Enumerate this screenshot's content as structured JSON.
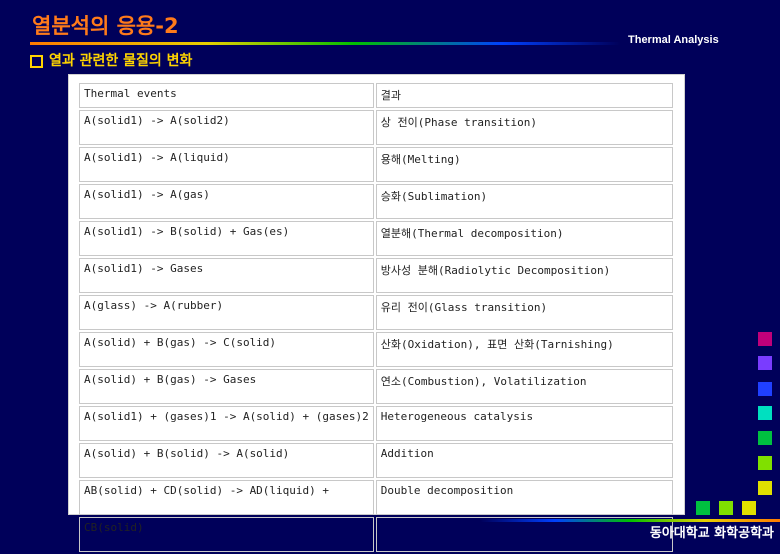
{
  "header": {
    "title": "열분석의 응용-2",
    "subtitle": "열과 관련한 물질의 변화",
    "corner_tag": "Thermal Analysis"
  },
  "table": {
    "headers": [
      "Thermal events",
      "결과"
    ],
    "rows": [
      [
        "A(solid1) -> A(solid2)",
        "상 전이(Phase transition)"
      ],
      [
        "A(solid1) -> A(liquid)",
        "용해(Melting)"
      ],
      [
        "A(solid1) -> A(gas)",
        "승화(Sublimation)"
      ],
      [
        "A(solid1) -> B(solid) + Gas(es)",
        "열분해(Thermal decomposition)"
      ],
      [
        "A(solid1) -> Gases",
        "방사성 분해(Radiolytic Decomposition)"
      ],
      [
        "A(glass) -> A(rubber)",
        "유리 전이(Glass transition)"
      ],
      [
        "A(solid) + B(gas) -> C(solid)",
        "산화(Oxidation), 표면 산화(Tarnishing)"
      ],
      [
        "A(solid) + B(gas) -> Gases",
        "연소(Combustion), Volatilization"
      ],
      [
        "A(solid1) + (gases)1 -> A(solid) + (gases)2",
        "Heterogeneous catalysis"
      ],
      [
        "A(solid) + B(solid) -> A(solid)",
        "Addition"
      ],
      [
        "AB(solid) + CD(solid) -> AD(liquid) +",
        "Double decomposition"
      ],
      [
        "CB(solid)",
        ""
      ]
    ]
  },
  "footer": {
    "text": "동아대학교 화학공학과"
  },
  "colors": {
    "background": "#00005a",
    "title": "#ff7a1a",
    "subtitle": "#ffd400",
    "squares": [
      "#c0007a",
      "#7a3cff",
      "#2040ff",
      "#00e0c0",
      "#00c040",
      "#80e000",
      "#e0e000"
    ]
  }
}
